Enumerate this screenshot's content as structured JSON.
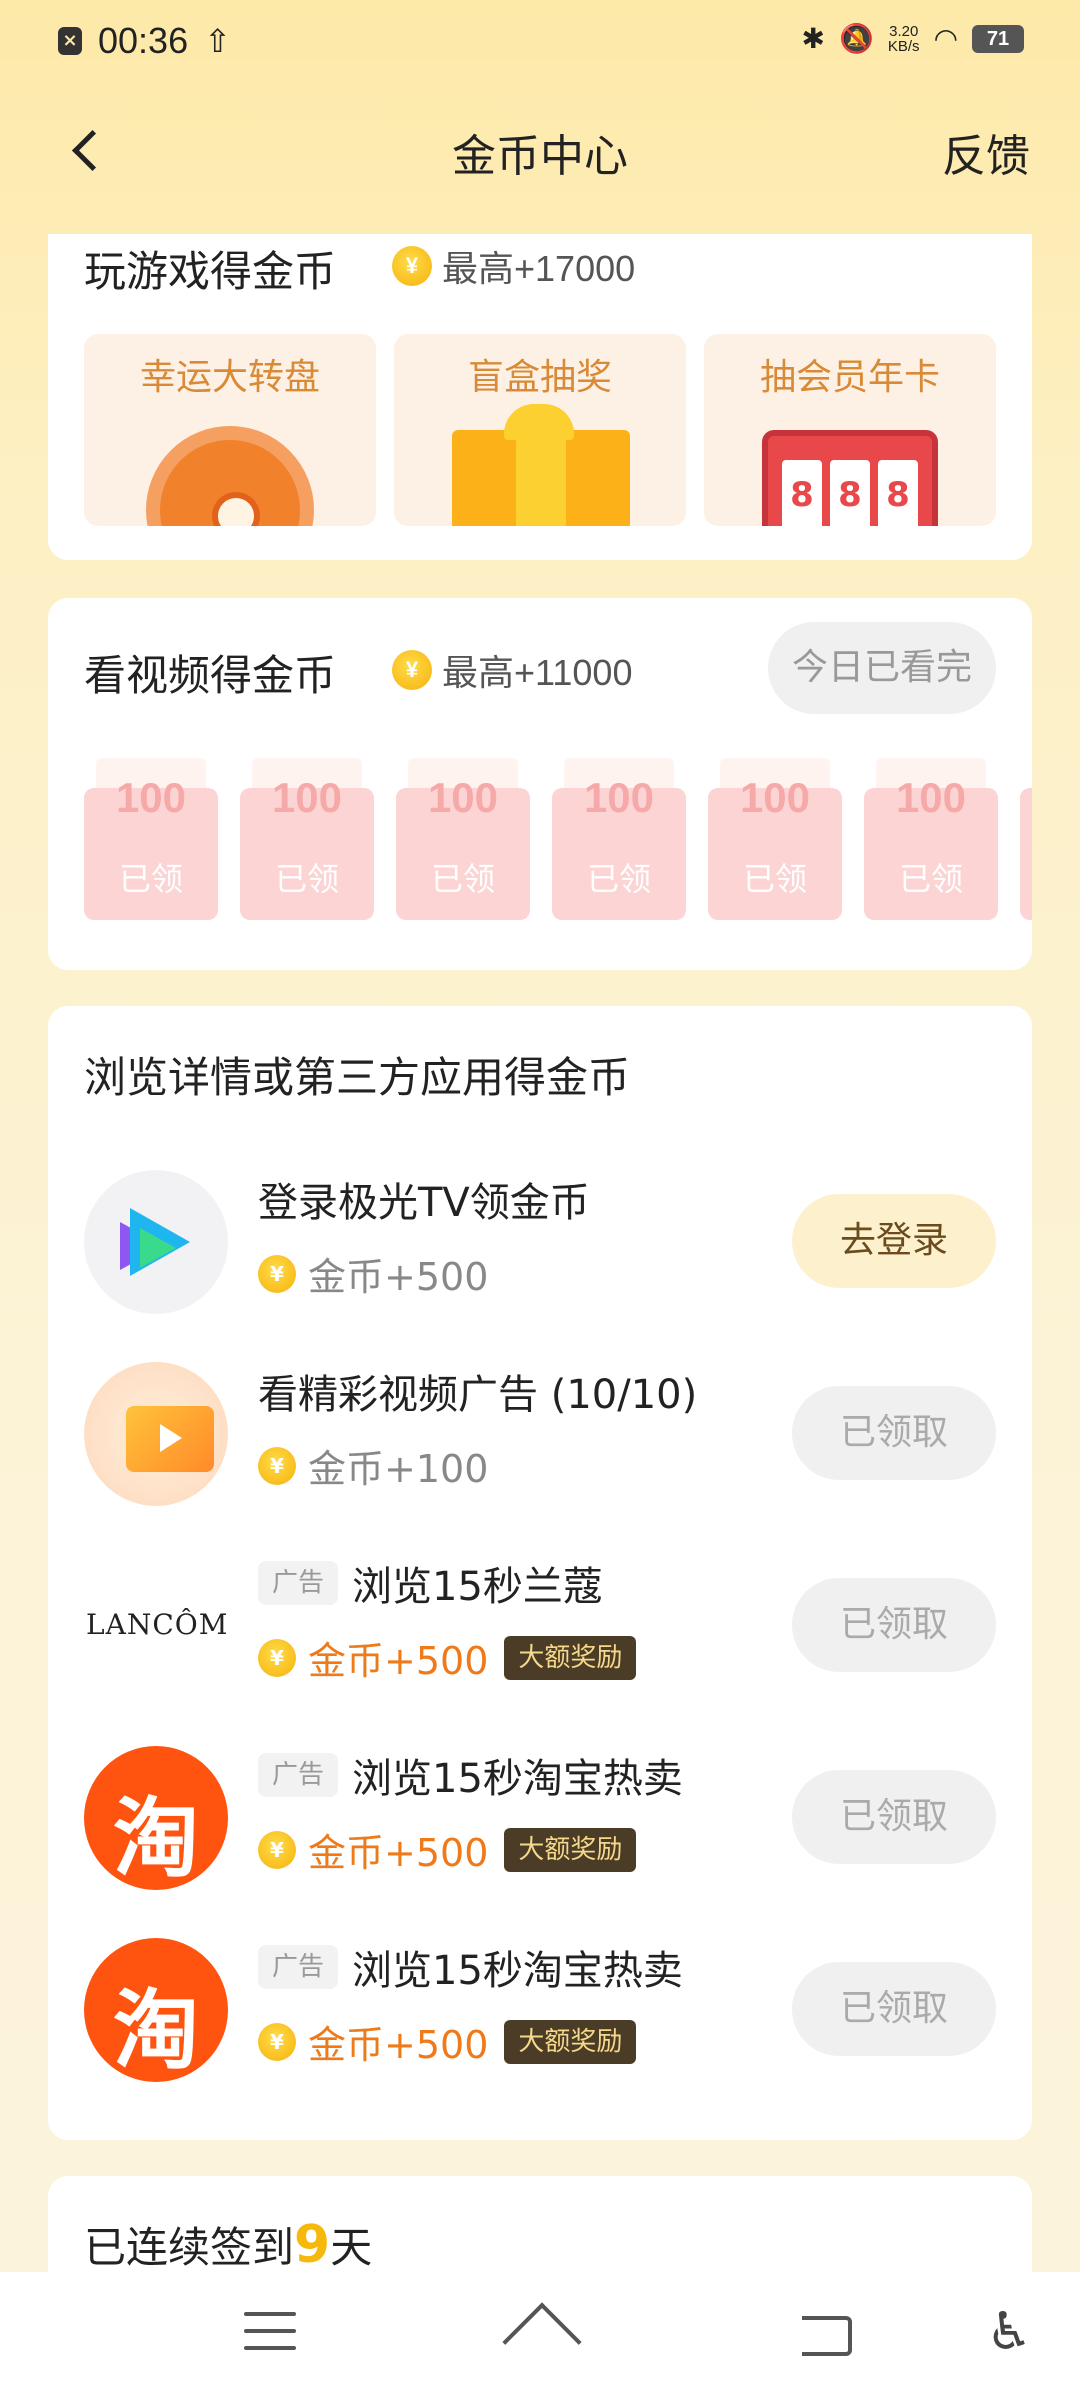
{
  "status_bar": {
    "time": "00:36",
    "net_speed_value": "3.20",
    "net_speed_unit": "KB/s",
    "battery": "71"
  },
  "header": {
    "title": "金币中心",
    "feedback": "反馈"
  },
  "games": {
    "title": "玩游戏得金币",
    "max_reward": "最高+17000",
    "items": [
      {
        "label": "幸运大转盘"
      },
      {
        "label": "盲盒抽奖"
      },
      {
        "label": "抽会员年卡",
        "slot_digits": [
          "8",
          "8",
          "8"
        ]
      }
    ]
  },
  "video": {
    "title": "看视频得金币",
    "max_reward": "最高+11000",
    "status_button": "今日已看完",
    "envelopes": [
      {
        "amount": "100",
        "status": "已领"
      },
      {
        "amount": "100",
        "status": "已领"
      },
      {
        "amount": "100",
        "status": "已领"
      },
      {
        "amount": "100",
        "status": "已领"
      },
      {
        "amount": "100",
        "status": "已领"
      },
      {
        "amount": "100",
        "status": "已领"
      }
    ]
  },
  "tasks": {
    "title": "浏览详情或第三方应用得金币",
    "items": [
      {
        "name": "登录极光TV领金币",
        "reward": "金币+500",
        "button": "去登录",
        "icon": "jiguang-tv-icon"
      },
      {
        "name": "看精彩视频广告 (10/10)",
        "reward": "金币+100",
        "button": "已领取",
        "icon": "video-ad-icon"
      },
      {
        "ad_tag": "广告",
        "name": "浏览15秒兰蔻",
        "reward": "金币+500",
        "badge": "大额奖励",
        "button": "已领取",
        "icon": "lancome-logo",
        "logo_text": "LANCÔME"
      },
      {
        "ad_tag": "广告",
        "name": "浏览15秒淘宝热卖",
        "reward": "金币+500",
        "badge": "大额奖励",
        "button": "已领取",
        "icon": "taobao-logo",
        "logo_text": "淘"
      },
      {
        "ad_tag": "广告",
        "name": "浏览15秒淘宝热卖",
        "reward": "金币+500",
        "badge": "大额奖励",
        "button": "已领取",
        "icon": "taobao-logo",
        "logo_text": "淘"
      }
    ]
  },
  "signin": {
    "prefix": "已连续签到",
    "days": "9",
    "suffix": "天"
  },
  "colors": {
    "accent_yellow": "#f6b80b",
    "reward_orange": "#ef7a1a",
    "page_bg": "#fdf0c4"
  }
}
